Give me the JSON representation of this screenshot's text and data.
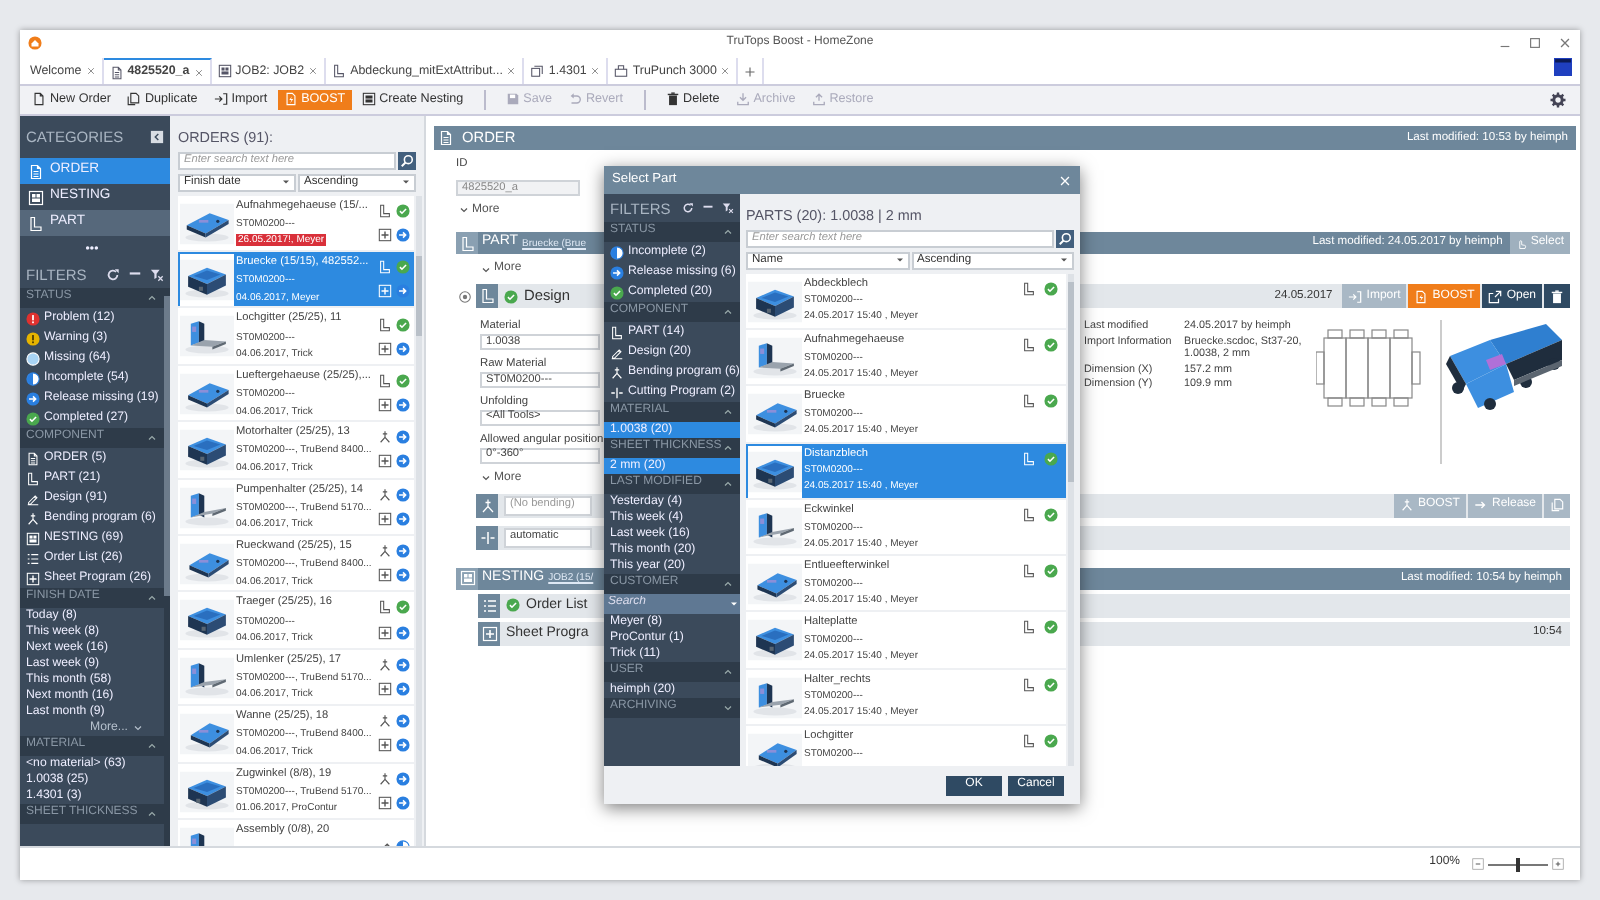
{
  "window": {
    "title": "TruTops Boost - HomeZone"
  },
  "tabs": [
    {
      "label": "Welcome",
      "kind": "home",
      "selected": false
    },
    {
      "label": "4825520_a",
      "kind": "order",
      "selected": true
    },
    {
      "label": "JOB2: JOB2",
      "kind": "nesting",
      "selected": false
    },
    {
      "label": "Abdeckung_mitExtAttribut...",
      "kind": "part",
      "selected": false
    },
    {
      "label": "1.4301",
      "kind": "material",
      "selected": false
    },
    {
      "label": "TruPunch 3000",
      "kind": "machine",
      "selected": false
    }
  ],
  "toolbar_groups": [
    [
      {
        "label": "New Order",
        "kind": "new",
        "disabled": false
      },
      {
        "label": "Duplicate",
        "kind": "duplicate",
        "disabled": false
      },
      {
        "label": "Import",
        "kind": "import",
        "disabled": false
      },
      {
        "label": "BOOST",
        "kind": "boost",
        "disabled": false
      },
      {
        "label": "Create Nesting",
        "kind": "createnesting",
        "disabled": false
      }
    ],
    [
      {
        "label": "Save",
        "kind": "save",
        "disabled": true
      },
      {
        "label": "Revert",
        "kind": "revert",
        "disabled": true
      }
    ],
    [
      {
        "label": "Delete",
        "kind": "trash",
        "disabled": false
      },
      {
        "label": "Archive",
        "kind": "archive",
        "disabled": true
      },
      {
        "label": "Restore",
        "kind": "restore",
        "disabled": true
      }
    ]
  ],
  "categories": {
    "title": "CATEGORIES",
    "items": [
      {
        "label": "ORDER",
        "kind": "order",
        "selected": true,
        "hovered": false
      },
      {
        "label": "NESTING",
        "kind": "nesting",
        "selected": false,
        "hovered": false
      },
      {
        "label": "PART",
        "kind": "part",
        "selected": false,
        "hovered": true
      }
    ],
    "more": "•••"
  },
  "filters": {
    "title": "FILTERS",
    "sections": [
      {
        "title": "STATUS",
        "expanded": true,
        "items": [
          {
            "label": "Problem (12)",
            "kind": "problem"
          },
          {
            "label": "Warning (3)",
            "kind": "warning"
          },
          {
            "label": "Missing (64)",
            "kind": "missing"
          },
          {
            "label": "Incomplete (54)",
            "kind": "incomplete"
          },
          {
            "label": "Release missing (19)",
            "kind": "release"
          },
          {
            "label": "Completed (27)",
            "kind": "completed"
          }
        ]
      },
      {
        "title": "COMPONENT",
        "expanded": true,
        "items": [
          {
            "label": "ORDER (5)",
            "kind": "order"
          },
          {
            "label": "PART (21)",
            "kind": "part"
          },
          {
            "label": "Design (91)",
            "kind": "design"
          },
          {
            "label": "Bending program (6)",
            "kind": "bending"
          },
          {
            "label": "NESTING (69)",
            "kind": "nesting"
          },
          {
            "label": "Order List (26)",
            "kind": "orderlist"
          },
          {
            "label": "Sheet Program (26)",
            "kind": "sheet"
          }
        ]
      },
      {
        "title": "FINISH DATE",
        "expanded": true,
        "items": [
          {
            "label": "Today (8)"
          },
          {
            "label": "This week (8)"
          },
          {
            "label": "Next week (16)"
          },
          {
            "label": "Last week (9)"
          },
          {
            "label": "This month (58)"
          },
          {
            "label": "Next month (16)"
          },
          {
            "label": "Last month (9)"
          }
        ],
        "more": "More..."
      },
      {
        "title": "MATERIAL",
        "expanded": true,
        "items": [
          {
            "label": "<no material> (63)"
          },
          {
            "label": "1.0038 (25)"
          },
          {
            "label": "1.4301 (3)"
          }
        ]
      },
      {
        "title": "SHEET THICKNESS",
        "expanded": true
      }
    ]
  },
  "orders": {
    "title": "ORDERS (91):",
    "search_placeholder": "Enter search text here",
    "sort_field": "Finish date",
    "sort_order": "Ascending",
    "cards": [
      {
        "name": "Aufnahmegehaeuse (15/...",
        "line2": "ST0M0200---",
        "date": "26.05.2017!, Meyer",
        "overdue": true,
        "selected": false,
        "kind": "part"
      },
      {
        "name": "Bruecke (15/15), 482552...",
        "line2": "ST0M0200---",
        "date": "04.06.2017, Meyer",
        "overdue": false,
        "selected": true,
        "kind": "part"
      },
      {
        "name": "Lochgitter (25/25), 11",
        "line2": "ST0M0200---",
        "date": "04.06.2017, Trick",
        "overdue": false,
        "selected": false,
        "kind": "part"
      },
      {
        "name": "Lueftergehaeuse (25/25),...",
        "line2": "ST0M0200---",
        "date": "04.06.2017, Trick",
        "overdue": false,
        "selected": false,
        "kind": "part"
      },
      {
        "name": "Motorhalter (25/25), 13",
        "line2": "ST0M0200---, TruBend 8400...",
        "date": "04.06.2017, Trick",
        "overdue": false,
        "selected": false,
        "kind": "bending"
      },
      {
        "name": "Pumpenhalter (25/25), 14",
        "line2": "ST0M0200---, TruBend 5170...",
        "date": "04.06.2017, Trick",
        "overdue": false,
        "selected": false,
        "kind": "bending"
      },
      {
        "name": "Rueckwand (25/25), 15",
        "line2": "ST0M0200---, TruBend 8400...",
        "date": "04.06.2017, Trick",
        "overdue": false,
        "selected": false,
        "kind": "bending"
      },
      {
        "name": "Traeger (25/25), 16",
        "line2": "ST0M0200---",
        "date": "04.06.2017, Trick",
        "overdue": false,
        "selected": false,
        "kind": "part"
      },
      {
        "name": "Umlenker (25/25), 17",
        "line2": "ST0M0200---, TruBend 5170...",
        "date": "04.06.2017, Trick",
        "overdue": false,
        "selected": false,
        "kind": "bending"
      },
      {
        "name": "Wanne (25/25), 18",
        "line2": "ST0M0200---, TruBend 8400...",
        "date": "04.06.2017, Trick",
        "overdue": false,
        "selected": false,
        "kind": "bending"
      },
      {
        "name": "Zugwinkel (8/8), 19",
        "line2": "ST0M0200---, TruBend 5170...",
        "date": "01.06.2017, ProContur",
        "overdue": false,
        "selected": false,
        "kind": "bending"
      },
      {
        "name": "Assembly (0/8), 20",
        "selected": false,
        "kind": "design"
      }
    ]
  },
  "order_panel": {
    "title": "ORDER",
    "last_modified": "Last modified: 10:53 by heimph",
    "id_label": "ID",
    "id_value": "4825520_a",
    "more": "More",
    "part": {
      "title": "PART",
      "link": "Bruecke (Brue",
      "last_modified": "Last modified: 24.05.2017 by heimph",
      "select": "Select",
      "more": "More",
      "design": {
        "label": "Design",
        "date": "24.05.2017",
        "buttons": [
          {
            "label": "Import",
            "kind": "import",
            "disabled": true
          },
          {
            "label": "BOOST",
            "kind": "boost",
            "disabled": false
          },
          {
            "label": "Open",
            "kind": "open",
            "disabled": false
          },
          {
            "kind": "trash",
            "disabled": false
          }
        ]
      },
      "fields": [
        {
          "label": "Material",
          "value": "1.0038"
        },
        {
          "label": "Raw Material",
          "value": "ST0M0200---"
        },
        {
          "label": "Unfolding",
          "value": "<All Tools>"
        },
        {
          "label": "Allowed angular position",
          "value": "0°-360°"
        }
      ],
      "info": [
        {
          "label": "Last modified",
          "value": "24.05.2017 by heimph"
        },
        {
          "label": "Import Information",
          "value": "Bruecke.scdoc, St37-20, 1.0038, 2 mm"
        },
        {
          "label": "Dimension (X)",
          "value": "157.2 mm"
        },
        {
          "label": "Dimension (Y)",
          "value": "109.9 mm"
        }
      ],
      "more2": "More",
      "programs": [
        {
          "kind": "bending",
          "placeholder": "(No bending)",
          "buttons": [
            {
              "label": "BOOST",
              "kind": "bending",
              "disabled": true
            },
            {
              "label": "Release",
              "kind": "release_arrow",
              "disabled": true
            },
            {
              "kind": "duplicate",
              "disabled": true
            }
          ]
        },
        {
          "kind": "cutting",
          "value": "automatic"
        }
      ]
    },
    "nesting": {
      "title": "NESTING",
      "link": "JOB2 (15/",
      "last_modified": "Last modified: 10:54 by heimph",
      "rows": [
        {
          "kind": "orderlist",
          "label": "Order List"
        },
        {
          "kind": "sheet",
          "label": "Sheet Progra",
          "time": "10:54"
        }
      ]
    }
  },
  "status_bar": {
    "zoom": "100%",
    "level": 0.5
  },
  "dialog": {
    "title": "Select Part",
    "filters": {
      "title": "FILTERS",
      "sections": [
        {
          "title": "STATUS",
          "expanded": true,
          "items": [
            {
              "label": "Incomplete (2)",
              "kind": "incomplete",
              "selected": false
            },
            {
              "label": "Release missing (6)",
              "kind": "release",
              "selected": false
            },
            {
              "label": "Completed (20)",
              "kind": "completed",
              "selected": false
            }
          ]
        },
        {
          "title": "COMPONENT",
          "expanded": true,
          "items": [
            {
              "label": "PART (14)",
              "kind": "part",
              "selected": false
            },
            {
              "label": "Design (20)",
              "kind": "design",
              "selected": false
            },
            {
              "label": "Bending program (6)",
              "kind": "bending",
              "selected": false
            },
            {
              "label": "Cutting Program (2)",
              "kind": "cutting",
              "selected": false
            }
          ]
        },
        {
          "title": "MATERIAL",
          "expanded": true,
          "items": [
            {
              "label": "1.0038 (20)",
              "selected": true
            }
          ]
        },
        {
          "title": "SHEET THICKNESS",
          "expanded": true,
          "items": [
            {
              "label": "2 mm (20)",
              "selected": true
            }
          ]
        },
        {
          "title": "LAST MODIFIED",
          "expanded": true,
          "items": [
            {
              "label": "Yesterday (4)",
              "selected": false
            },
            {
              "label": "This week (4)",
              "selected": false
            },
            {
              "label": "Last week (16)",
              "selected": false
            },
            {
              "label": "This month (20)",
              "selected": false
            },
            {
              "label": "This year (20)",
              "selected": false
            }
          ]
        },
        {
          "title": "CUSTOMER",
          "expanded": true,
          "search_placeholder": "Search",
          "items": [
            {
              "label": "Meyer (8)",
              "selected": false
            },
            {
              "label": "ProContur (1)",
              "selected": false
            },
            {
              "label": "Trick (11)",
              "selected": false
            }
          ]
        },
        {
          "title": "USER",
          "expanded": true,
          "items": [
            {
              "label": "heimph (20)",
              "selected": false
            }
          ]
        },
        {
          "title": "ARCHIVING",
          "expanded": false
        }
      ]
    },
    "parts_title": "PARTS (20): 1.0038 | 2 mm",
    "search_placeholder": "Enter search text here",
    "sort_field": "Name",
    "sort_order": "Ascending",
    "parts": [
      {
        "name": "Abdeckblech",
        "line2": "ST0M0200---",
        "date": "24.05.2017 15:40 , Meyer",
        "selected": false
      },
      {
        "name": "Aufnahmegehaeuse",
        "line2": "ST0M0200---",
        "date": "24.05.2017 15:40 , Meyer",
        "selected": false
      },
      {
        "name": "Bruecke",
        "line2": "ST0M0200---",
        "date": "24.05.2017 15:40 , Meyer",
        "selected": false
      },
      {
        "name": "Distanzblech",
        "line2": "ST0M0200---",
        "date": "24.05.2017 15:40 , Meyer",
        "selected": true
      },
      {
        "name": "Eckwinkel",
        "line2": "ST0M0200---",
        "date": "24.05.2017 15:40 , Meyer",
        "selected": false
      },
      {
        "name": "Entlueefterwinkel",
        "line2": "ST0M0200---",
        "date": "24.05.2017 15:40 , Meyer",
        "selected": false
      },
      {
        "name": "Halteplatte",
        "line2": "ST0M0200---",
        "date": "24.05.2017 15:40 , Meyer",
        "selected": false
      },
      {
        "name": "Halter_rechts",
        "line2": "ST0M0200---",
        "date": "24.05.2017 15:40 , Meyer",
        "selected": false
      },
      {
        "name": "Lochgitter",
        "line2": "ST0M0200---",
        "selected": false
      }
    ],
    "ok": "OK",
    "cancel": "Cancel"
  }
}
